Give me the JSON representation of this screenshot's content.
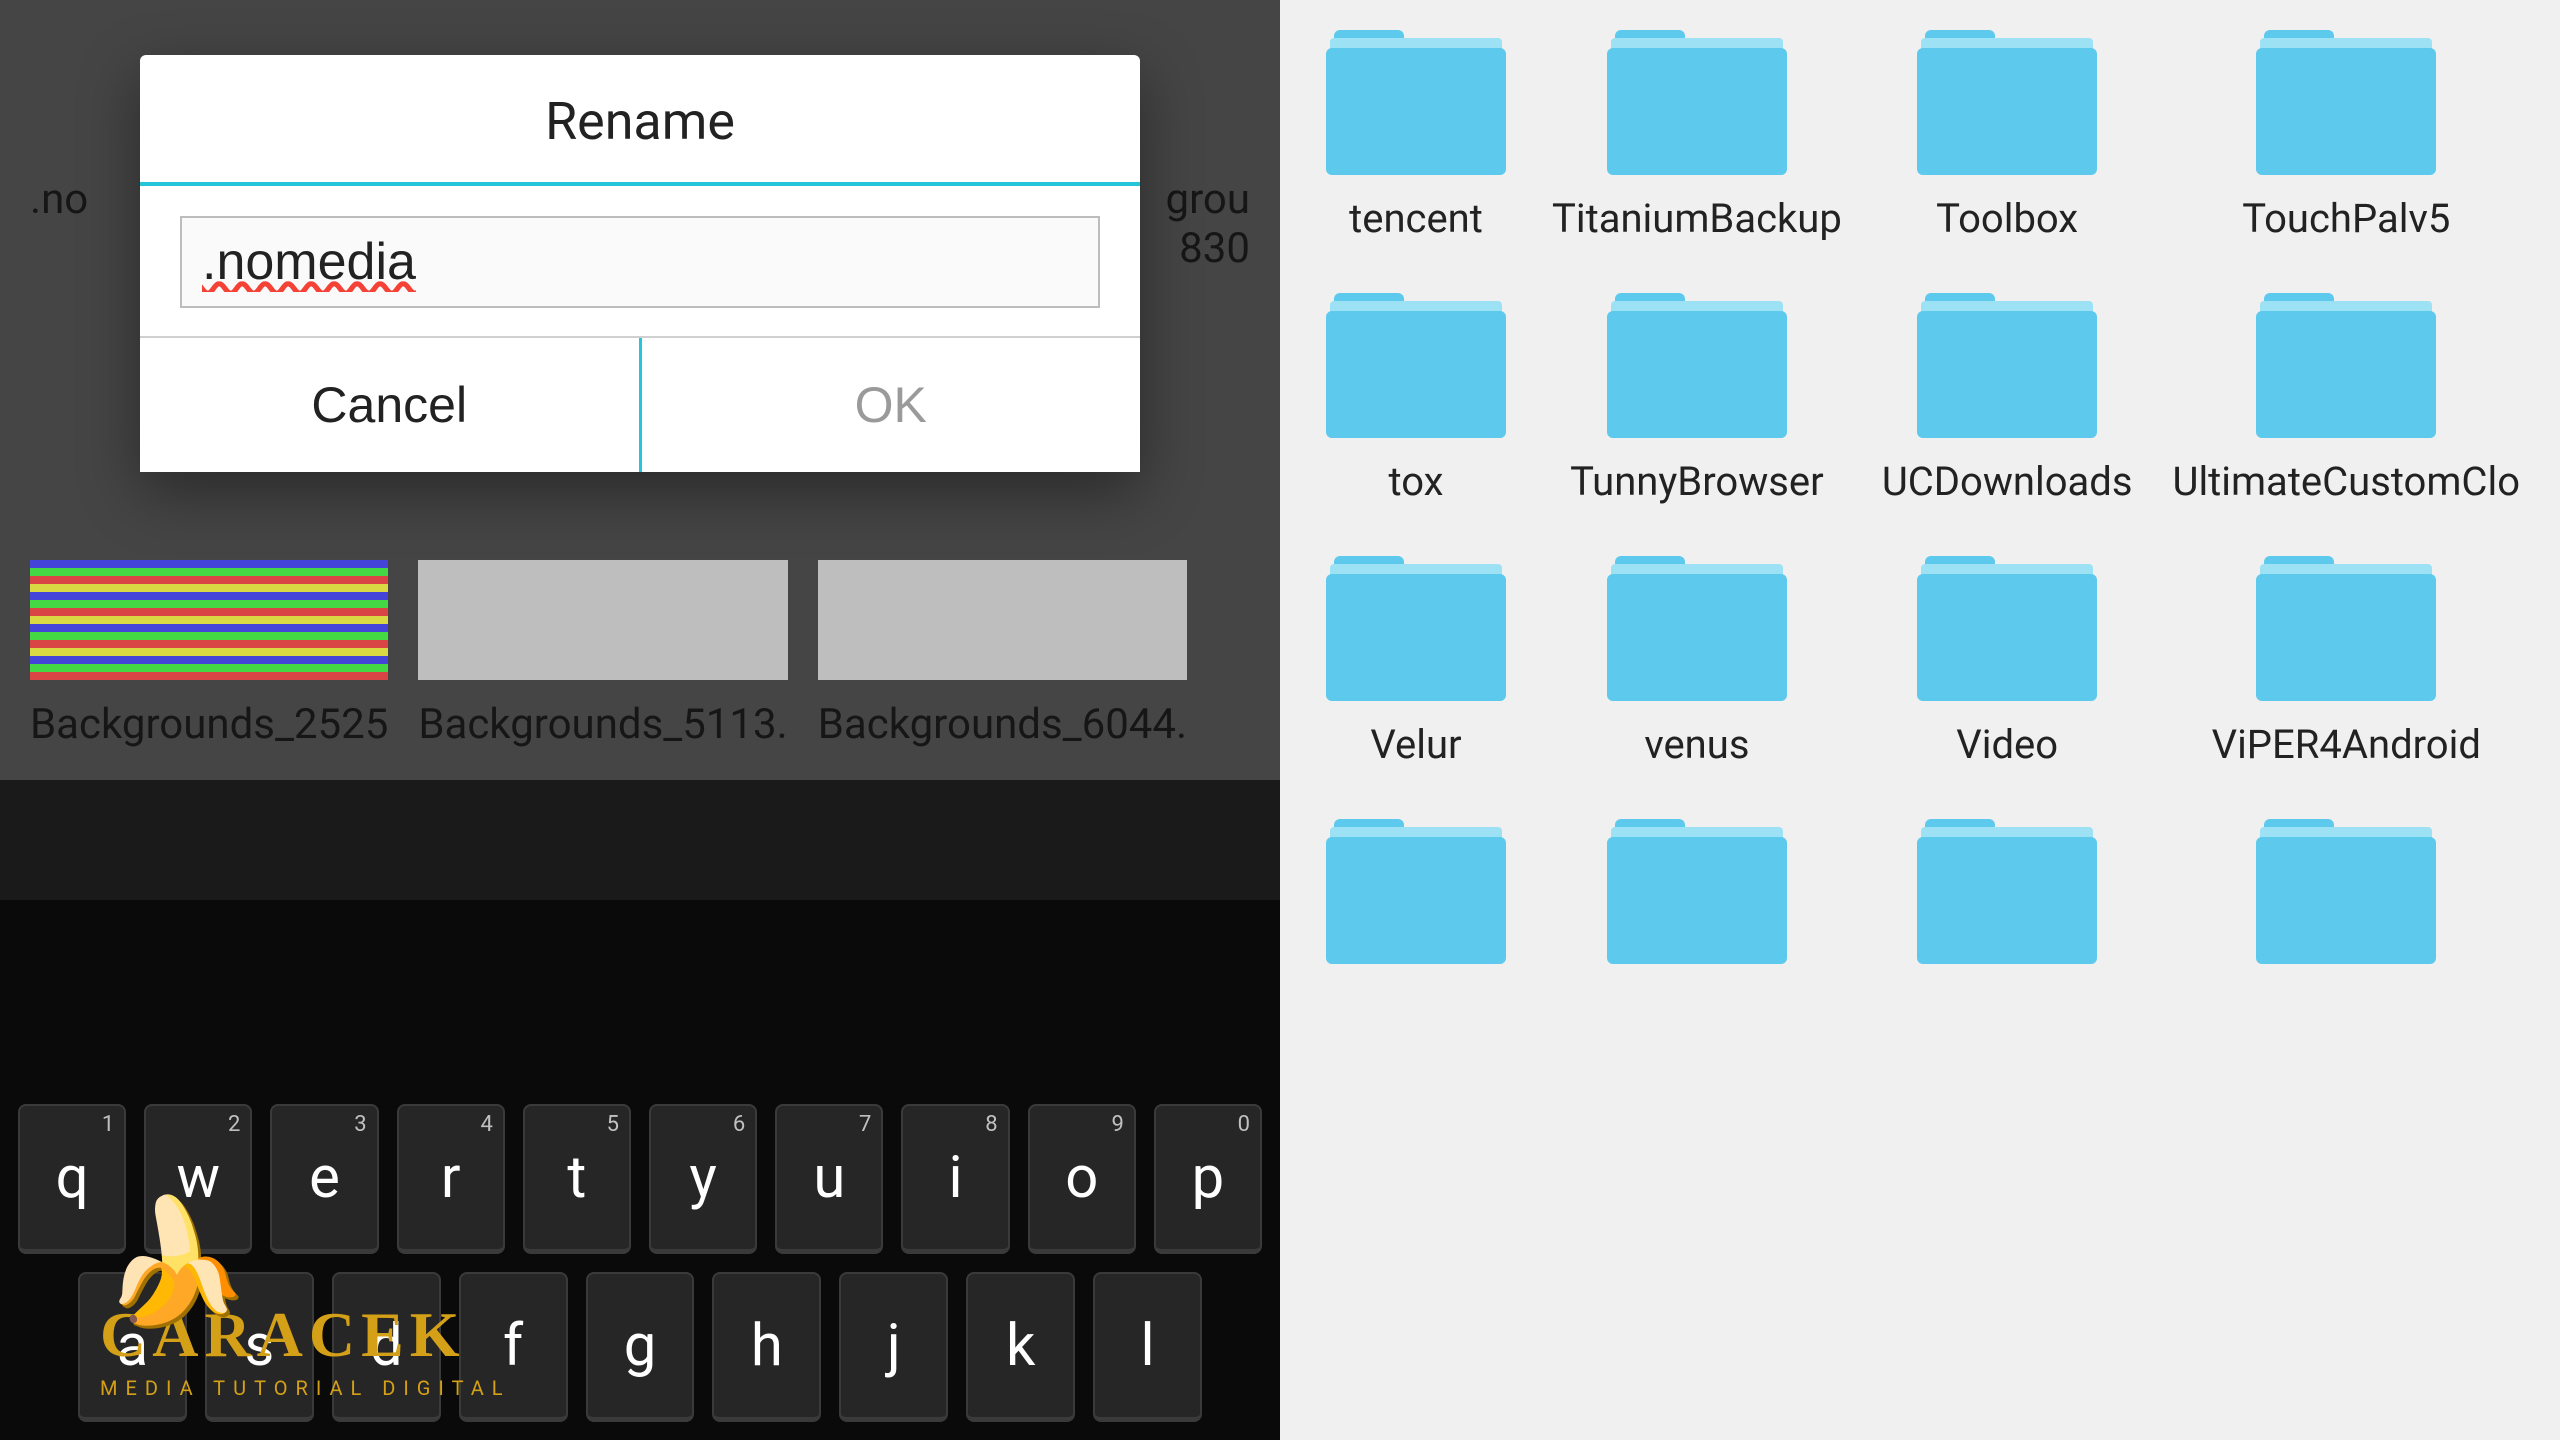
{
  "dialog": {
    "title": "Rename",
    "input_value": ".nomedia",
    "cancel_label": "Cancel",
    "ok_label": "OK"
  },
  "left_edges": {
    "left_text": ".no",
    "right_text": "grou\n830"
  },
  "background_items": [
    {
      "label": "Backgrounds_2525",
      "thumb_class": "stripes"
    },
    {
      "label": "Backgrounds_5113.",
      "thumb_class": "blank"
    },
    {
      "label": "Backgrounds_6044.",
      "thumb_class": "blank"
    }
  ],
  "keyboard": {
    "row1": [
      {
        "char": "q",
        "num": "1"
      },
      {
        "char": "w",
        "num": "2"
      },
      {
        "char": "e",
        "num": "3"
      },
      {
        "char": "r",
        "num": "4"
      },
      {
        "char": "t",
        "num": "5"
      },
      {
        "char": "y",
        "num": "6"
      },
      {
        "char": "u",
        "num": "7"
      },
      {
        "char": "i",
        "num": "8"
      },
      {
        "char": "o",
        "num": "9"
      },
      {
        "char": "p",
        "num": "0"
      }
    ],
    "row2": [
      {
        "char": "a"
      },
      {
        "char": "s"
      },
      {
        "char": "d"
      },
      {
        "char": "f"
      },
      {
        "char": "g"
      },
      {
        "char": "h"
      },
      {
        "char": "j"
      },
      {
        "char": "k"
      },
      {
        "char": "l"
      }
    ]
  },
  "watermark": {
    "title": "CARACEK",
    "subtitle": "MEDIA TUTORIAL DIGITAL"
  },
  "folders": [
    "tencent",
    "TitaniumBackup",
    "Toolbox",
    "TouchPalv5",
    "tox",
    "TunnyBrowser",
    "UCDownloads",
    "UltimateCustomClo",
    "Velur",
    "venus",
    "Video",
    "ViPER4Android",
    "",
    "",
    "",
    ""
  ]
}
